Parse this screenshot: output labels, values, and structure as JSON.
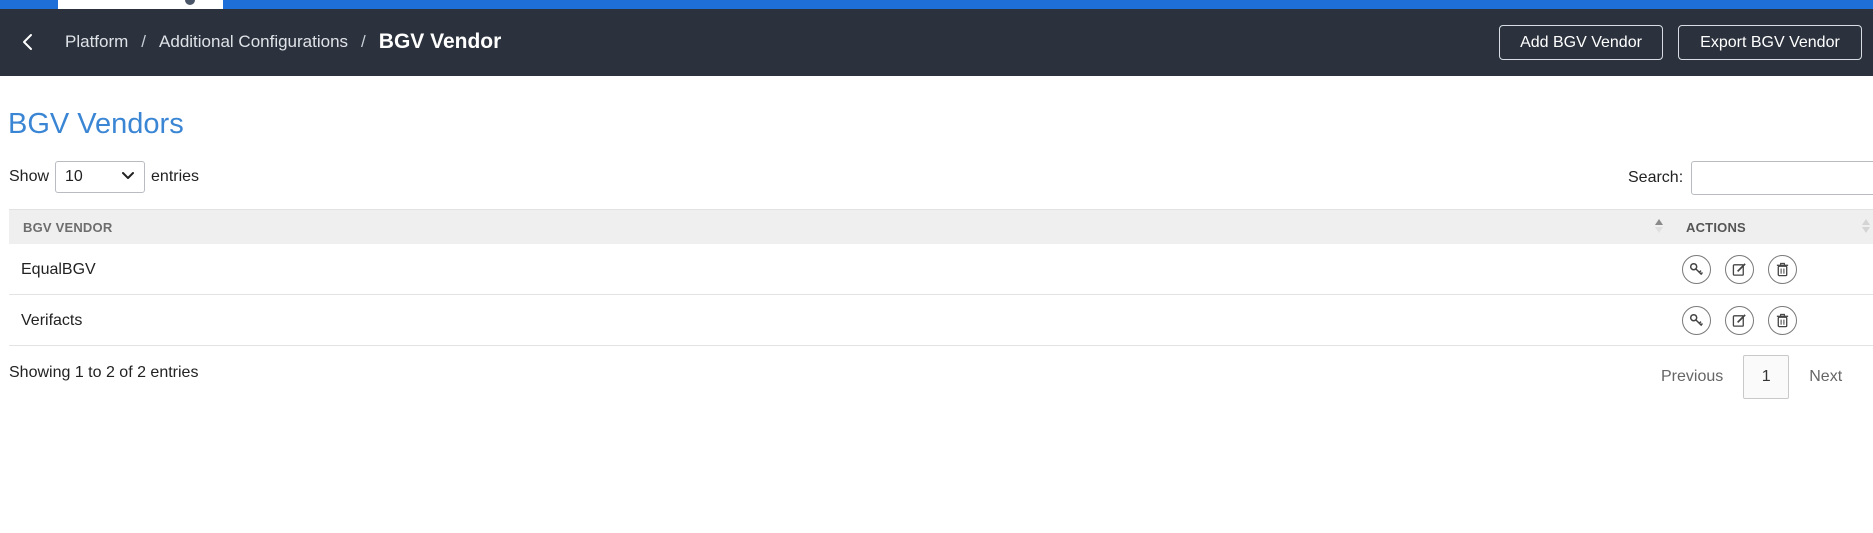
{
  "header": {
    "breadcrumb": [
      {
        "label": "Platform"
      },
      {
        "label": "Additional Configurations"
      }
    ],
    "separator": "/",
    "current": "BGV Vendor",
    "buttons": {
      "add": "Add BGV Vendor",
      "export": "Export BGV Vendor"
    },
    "back_icon": "chevron-left-icon"
  },
  "page": {
    "title": "BGV Vendors"
  },
  "controls": {
    "show_label": "Show",
    "length_value": "10",
    "entries_label": "entries",
    "search_label": "Search:",
    "search_value": ""
  },
  "table": {
    "columns": [
      "BGV VENDOR",
      "ACTIONS"
    ],
    "sorted_column": "BGV VENDOR",
    "sort_direction": "ascending",
    "rows": [
      {
        "name": "EqualBGV",
        "actions": [
          "key-icon",
          "edit-icon",
          "trash-icon"
        ]
      },
      {
        "name": "Verifacts",
        "actions": [
          "key-icon",
          "edit-icon",
          "trash-icon"
        ]
      }
    ]
  },
  "footer": {
    "info": "Showing 1 to 2 of 2 entries",
    "pagination": {
      "previous": "Previous",
      "current_page": "1",
      "next": "Next"
    }
  },
  "colors": {
    "top_strip": "#1f6fd8",
    "header_bg": "#2b323d",
    "title_accent": "#3a86d4",
    "table_header_bg": "#efefef"
  }
}
